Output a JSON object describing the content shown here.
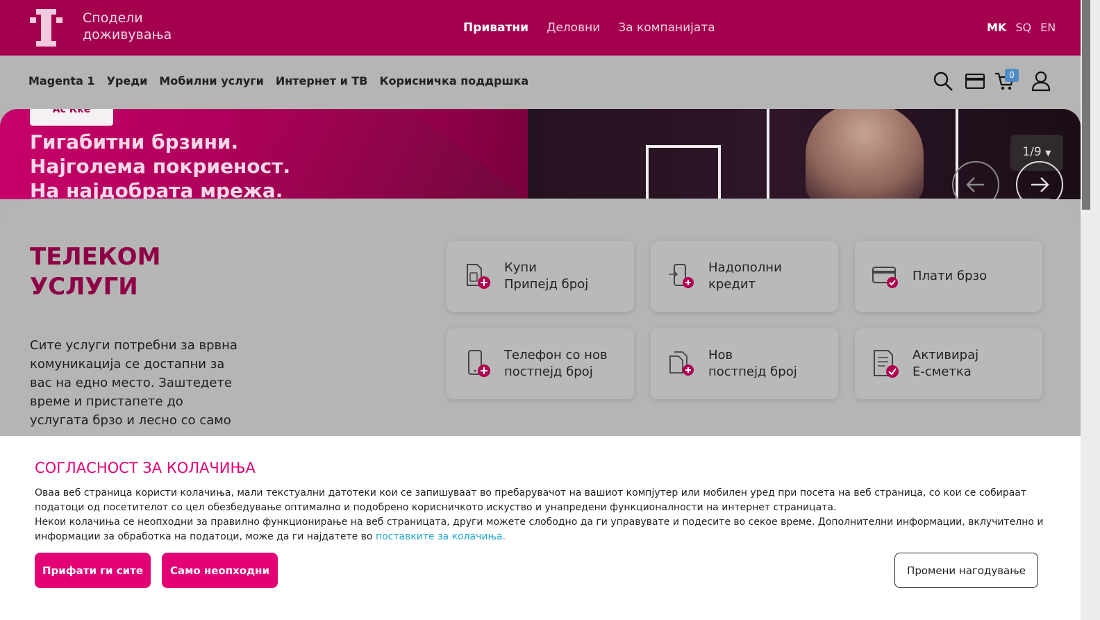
{
  "header": {
    "tagline_line1": "Сподели",
    "tagline_line2": "доживувања",
    "segments": [
      "Приватни",
      "Деловни",
      "За компанијата"
    ],
    "languages": [
      "MK",
      "SQ",
      "EN"
    ],
    "brand_color": "#e20074"
  },
  "nav": {
    "items": [
      "Magenta 1",
      "Уреди",
      "Мобилни услуги",
      "Интернет и ТВ",
      "Корисничка поддршка"
    ],
    "cart_count": "0",
    "icons": [
      "search-icon",
      "payment-card-icon",
      "cart-icon",
      "user-icon"
    ]
  },
  "hero": {
    "tag": "Ас   Кке",
    "headline_line1": "Гигабитни брзини.",
    "headline_line2": "Најголема покриеност.",
    "headline_line3": "На најдобрата мрежа.",
    "pager": "1/9"
  },
  "services": {
    "title_line1": "ТЕЛЕКОМ",
    "title_line2": "УСЛУГИ",
    "description": "Сите услуги потребни за врвна комуникација се достапни за вас на едно место. Заштедете време и пристапете до услугата брзо и лесно со само еден клик.",
    "cards": [
      {
        "line1": "Купи",
        "line2": "Припејд број"
      },
      {
        "line1": "Надополни",
        "line2": "кредит"
      },
      {
        "line1": "Плати брзо",
        "line2": ""
      },
      {
        "line1": "Телефон со нов",
        "line2": "постпејд број"
      },
      {
        "line1": "Нов",
        "line2": "постпејд број"
      },
      {
        "line1": "Активирај",
        "line2": "Е-сметка"
      }
    ]
  },
  "cookie": {
    "title": "СОГЛАСНОСТ ЗА КОЛАЧИЊА",
    "text1": "Оваа веб страница користи колачиња, мали текстуални датотеки кои се запишуваат во пребарувачот на вашиот компјутер или мобилен уред при посета на веб страница, со кои се собираат податоци од посетителот со цел обезбедување оптимално и подобрено корисничкото искуство и унапредени функционалности на интернет страницата.",
    "text2": "Некои колачиња се неопходни за правилно функционирање на веб страницата, други можете слободно да ги управувате и подесите во секое време. Дополнителни информации, вклучително и информации за обработка на податоци, може да ги најдатете во ",
    "link": "поставките за колачиња.",
    "accept_all": "Прифати ги сите",
    "necessary_only": "Само неопходни",
    "customize": "Промени нагодување"
  }
}
